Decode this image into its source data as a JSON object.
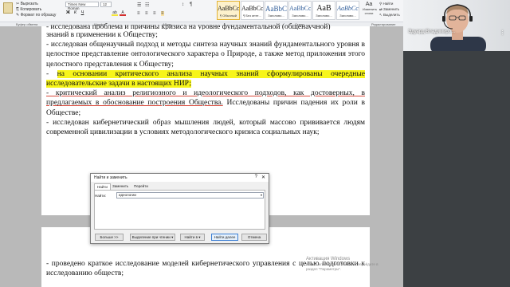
{
  "ribbon": {
    "clipboard": {
      "cut": "Вырезать",
      "copy": "Копировать",
      "format_painter": "Формат по образцу",
      "group": "Буфер обмена"
    },
    "font": {
      "name": "Times New Roman",
      "size": "12",
      "group": "Шрифт",
      "bold": "Ж",
      "italic": "К",
      "underline": "Ч"
    },
    "paragraph": {
      "group": "Абзац"
    },
    "styles": {
      "group": "Стили",
      "items": [
        {
          "sample": "AaBbCcI",
          "name": "¶ Обычный"
        },
        {
          "sample": "AaBbCcI",
          "name": "¶ Без инте..."
        },
        {
          "sample": "AaBbC",
          "name": "Заголово..."
        },
        {
          "sample": "AaBbCc",
          "name": "Заголово..."
        },
        {
          "sample": "AaB",
          "name": "Заголово..."
        },
        {
          "sample": "AaBbCc",
          "name": "Заголово..."
        }
      ],
      "change_styles": "Изменить стили"
    },
    "editing": {
      "find": "Найти",
      "replace": "Заменить",
      "select": "Выделить",
      "group": "Редактирование"
    }
  },
  "document": {
    "cut_line": "- исследована проблема и причины кризиса на уровне фундаментальной (общенаучной)",
    "paragraphs": [
      {
        "text": "знаний в применении к Обществу;"
      },
      {
        "text": "- исследован общенаучный подход и методы синтеза научных знаний фундаментального уровня в целостное представление онтологического характера  о Природе, а также метод приложения этого целостного представления к Обществу;"
      },
      {
        "prefix": "- ",
        "highlight": "на основании критического анализа научных знаний сформулированы очередные исследовательские задачи в настоящих НИР;"
      },
      {
        "underline": "- критический анализ религиозного и идеологического подходов, как достоверных, в предлагаемых в обоснование построения Общества.",
        "rest": " Исследованы причин падения их роли в Обществе;"
      },
      {
        "text": "- исследован кибернетический образ мышления людей, который массово прививается людям современной цивилизации в условиях методологического кризиса социальных наук;"
      }
    ],
    "page2": [
      {
        "text": "- проведено краткое исследование моделей кибернетического управления с целью подготовки к исследованию обществ;"
      }
    ]
  },
  "dialog": {
    "title": "Найти и заменить",
    "help": "?",
    "close": "✕",
    "tabs": [
      "Найти",
      "Заменить",
      "Перейти"
    ],
    "find_label": "Найти:",
    "find_value": "идеологии",
    "buttons": {
      "more": "Больше >>",
      "reading_highlight": "Выделение при чтении ▾",
      "find_in": "Найти в ▾",
      "find_next": "Найти далее",
      "cancel": "Отмена"
    }
  },
  "watermark": {
    "line1": "Активация Windows",
    "line2": "Чтобы активировать Windows, перейдите в",
    "line3": "раздел \"Параметры\"."
  },
  "webcam": {
    "name": "Эдуард Владимиро...",
    "more": "⋮"
  }
}
